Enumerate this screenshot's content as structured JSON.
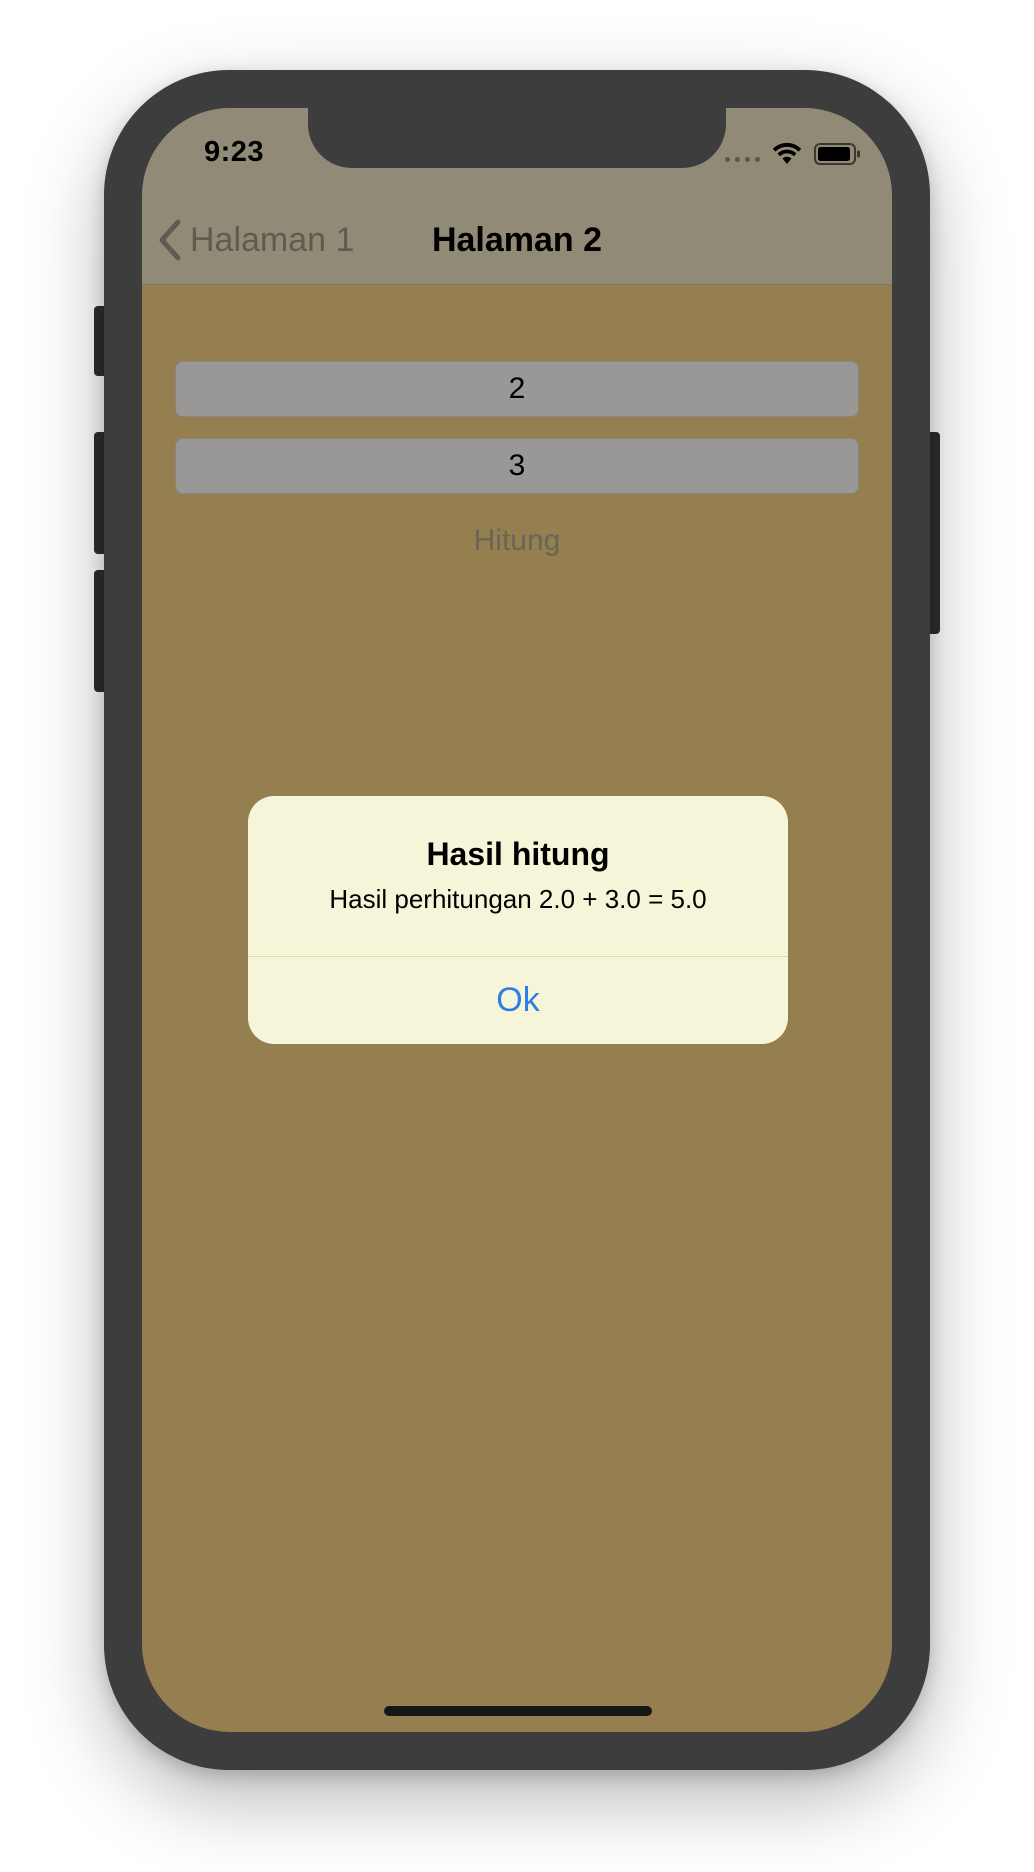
{
  "status_bar": {
    "time": "9:23",
    "icons": [
      "cellular-signal-icon",
      "wifi-icon",
      "battery-icon"
    ]
  },
  "nav": {
    "back_label": "Halaman 1",
    "title": "Halaman 2"
  },
  "form": {
    "first_value": "2",
    "second_value": "3",
    "calculate_label": "Hitung"
  },
  "alert": {
    "title": "Hasil hitung",
    "message": "Hasil perhitungan 2.0 + 3.0 = 5.0",
    "button_label": "Ok"
  },
  "colors": {
    "background": "#957f50",
    "navbar": "#908a76",
    "alert_background": "#f6f5d9",
    "alert_button": "#2f7ee3"
  }
}
